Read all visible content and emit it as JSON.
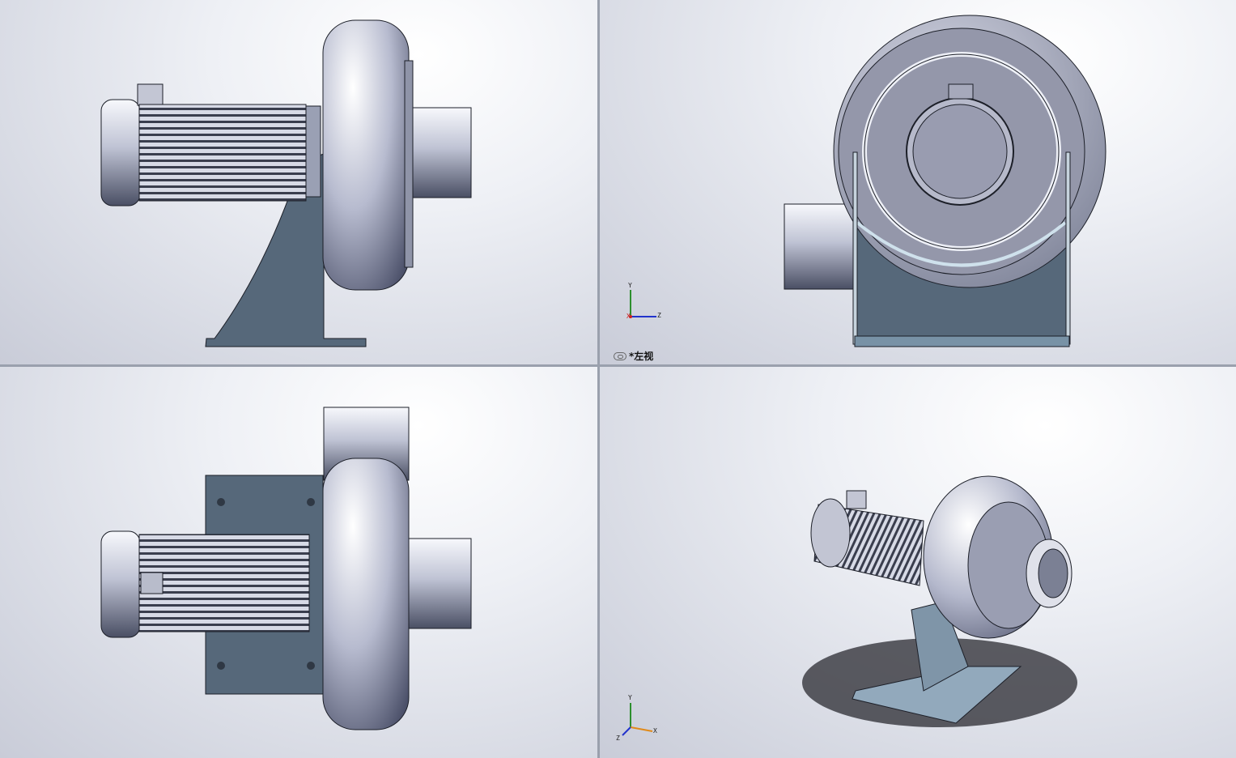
{
  "app": "SolidWorks",
  "viewports": [
    {
      "id": "top-left",
      "orientation": "front"
    },
    {
      "id": "top-right",
      "orientation": "left",
      "label": "*左视"
    },
    {
      "id": "bottom-left",
      "orientation": "top"
    },
    {
      "id": "bottom-right",
      "orientation": "isometric"
    }
  ],
  "triad_tr": {
    "y": "Y",
    "x": "X",
    "z": "Z"
  },
  "triad_br": {
    "y": "Y",
    "x": "X",
    "z": "Z"
  },
  "colors": {
    "steel": "#c5c9d8",
    "base": "#56687a",
    "edge": "#1c1f28",
    "split": "#9aa0ad"
  }
}
